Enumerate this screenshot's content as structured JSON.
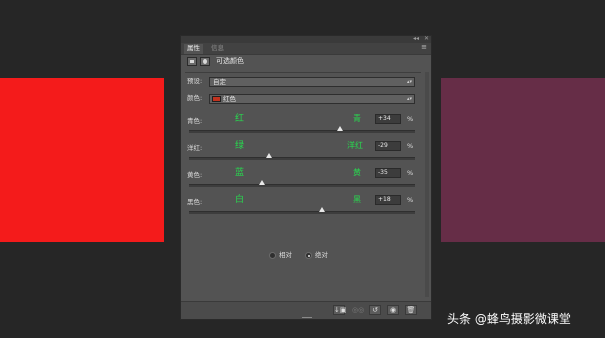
{
  "colors": {
    "background": "#262626",
    "left_swatch": "#f41b1b",
    "right_swatch": "#662d47",
    "slider_label_green": "#28d94f"
  },
  "panel": {
    "tabs": [
      "属性",
      "信息"
    ],
    "header_title": "可选颜色",
    "preset_label": "预设:",
    "preset_value": "自定",
    "color_label": "颜色:",
    "color_value": "红色",
    "sliders": [
      {
        "name": "青色:",
        "left": "红",
        "right": "青",
        "value": "+34",
        "unit": "%",
        "level": 34
      },
      {
        "name": "洋红:",
        "left": "绿",
        "right": "洋红",
        "value": "-29",
        "unit": "%",
        "level": -29
      },
      {
        "name": "黄色:",
        "left": "蓝",
        "right": "黄",
        "value": "-35",
        "unit": "%",
        "level": -35
      },
      {
        "name": "黑色:",
        "left": "白",
        "right": "黑",
        "value": "+18",
        "unit": "%",
        "level": 18
      }
    ],
    "method": {
      "relative": "相对",
      "absolute": "绝对",
      "selected": "absolute"
    }
  },
  "watermark": "头条 @蜂鸟摄影微课堂"
}
